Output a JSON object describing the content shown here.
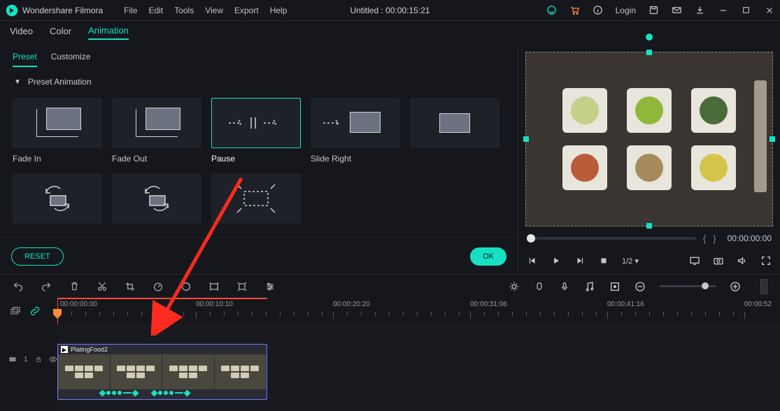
{
  "app": {
    "name": "Wondershare Filmora"
  },
  "menu": {
    "file": "File",
    "edit": "Edit",
    "tools": "Tools",
    "view": "View",
    "export": "Export",
    "help": "Help"
  },
  "title": "Untitled : 00:00:15:21",
  "login": "Login",
  "tabs": {
    "video": "Video",
    "color": "Color",
    "animation": "Animation"
  },
  "subtabs": {
    "preset": "Preset",
    "customize": "Customize"
  },
  "section": {
    "preset_animation": "Preset Animation"
  },
  "presets": {
    "fade_in": "Fade In",
    "fade_out": "Fade Out",
    "pause": "Pause",
    "slide_right": "Slide Right"
  },
  "buttons": {
    "reset": "RESET",
    "ok": "OK"
  },
  "preview": {
    "time": "00:00:00:00"
  },
  "player": {
    "ratio": "1/2"
  },
  "ruler": {
    "t0": "00:00:00:00",
    "t1": "00:00:10:10",
    "t2": "00:00:20:20",
    "t3": "00:00:31:06",
    "t4": "00:00:41:16",
    "t5": "00:00:52"
  },
  "clip": {
    "name": "PlatingFood2"
  },
  "track_label": "1"
}
